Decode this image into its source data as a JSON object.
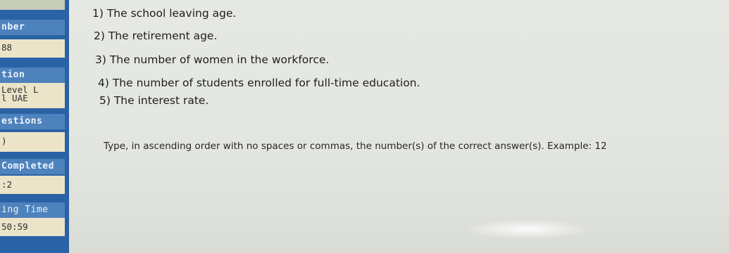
{
  "sidebar": {
    "sections": [
      {
        "heading": "nber",
        "lines": [
          "88"
        ]
      },
      {
        "heading": "tion",
        "lines": [
          "Level L",
          "l UAE"
        ]
      },
      {
        "heading": "estions",
        "lines": [
          ")"
        ]
      },
      {
        "heading": "Completed",
        "lines": [
          ":2"
        ]
      },
      {
        "heading": "ing Time",
        "lines": [
          "50:59"
        ]
      }
    ]
  },
  "question": {
    "options": [
      "1) The school leaving age.",
      "2) The retirement age.",
      "3) The number of women in the workforce.",
      "4) The number of students enrolled for full-time education.",
      "5) The interest rate."
    ],
    "instruction": "Type, in ascending order with no spaces or commas, the number(s) of the correct answer(s). Example: 12"
  }
}
